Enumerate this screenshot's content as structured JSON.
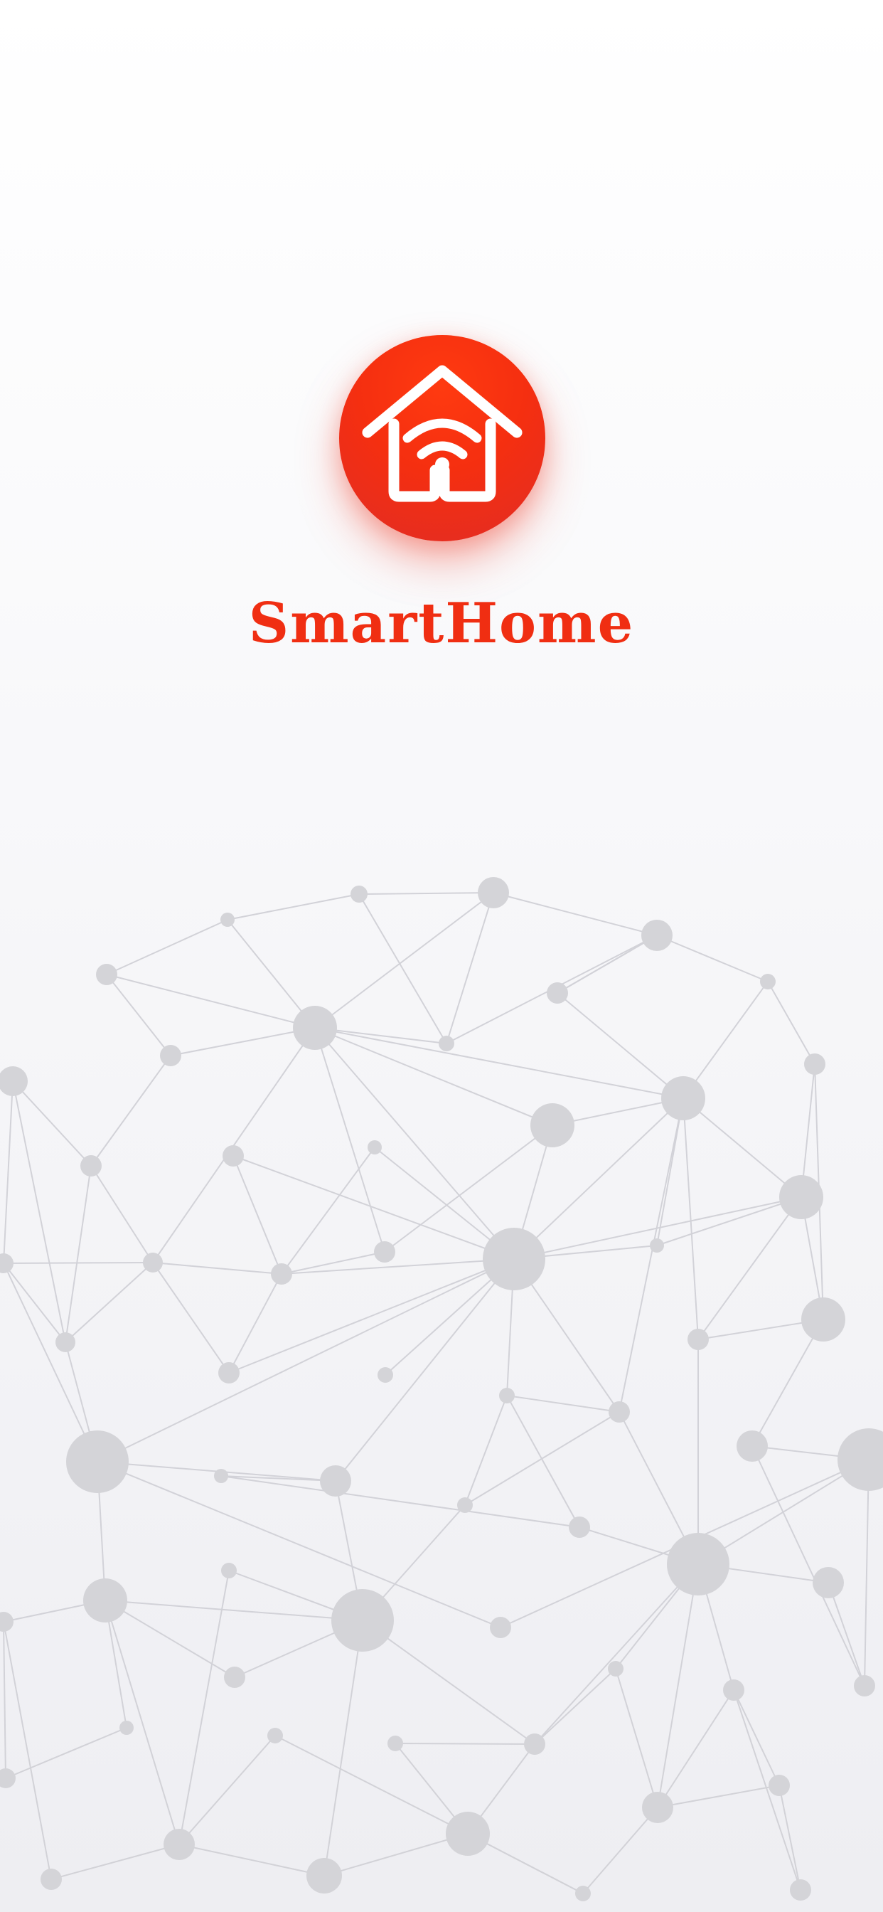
{
  "app": {
    "name": "SmartHome",
    "brand_color": "#f02e12",
    "logo_icon": "smart-home-wifi-icon"
  },
  "background": {
    "top_color": "#ffffff",
    "bottom_color": "#eeeef2",
    "network_node_color": "#d2d2d6",
    "network_line_color": "#d0d0d6"
  }
}
